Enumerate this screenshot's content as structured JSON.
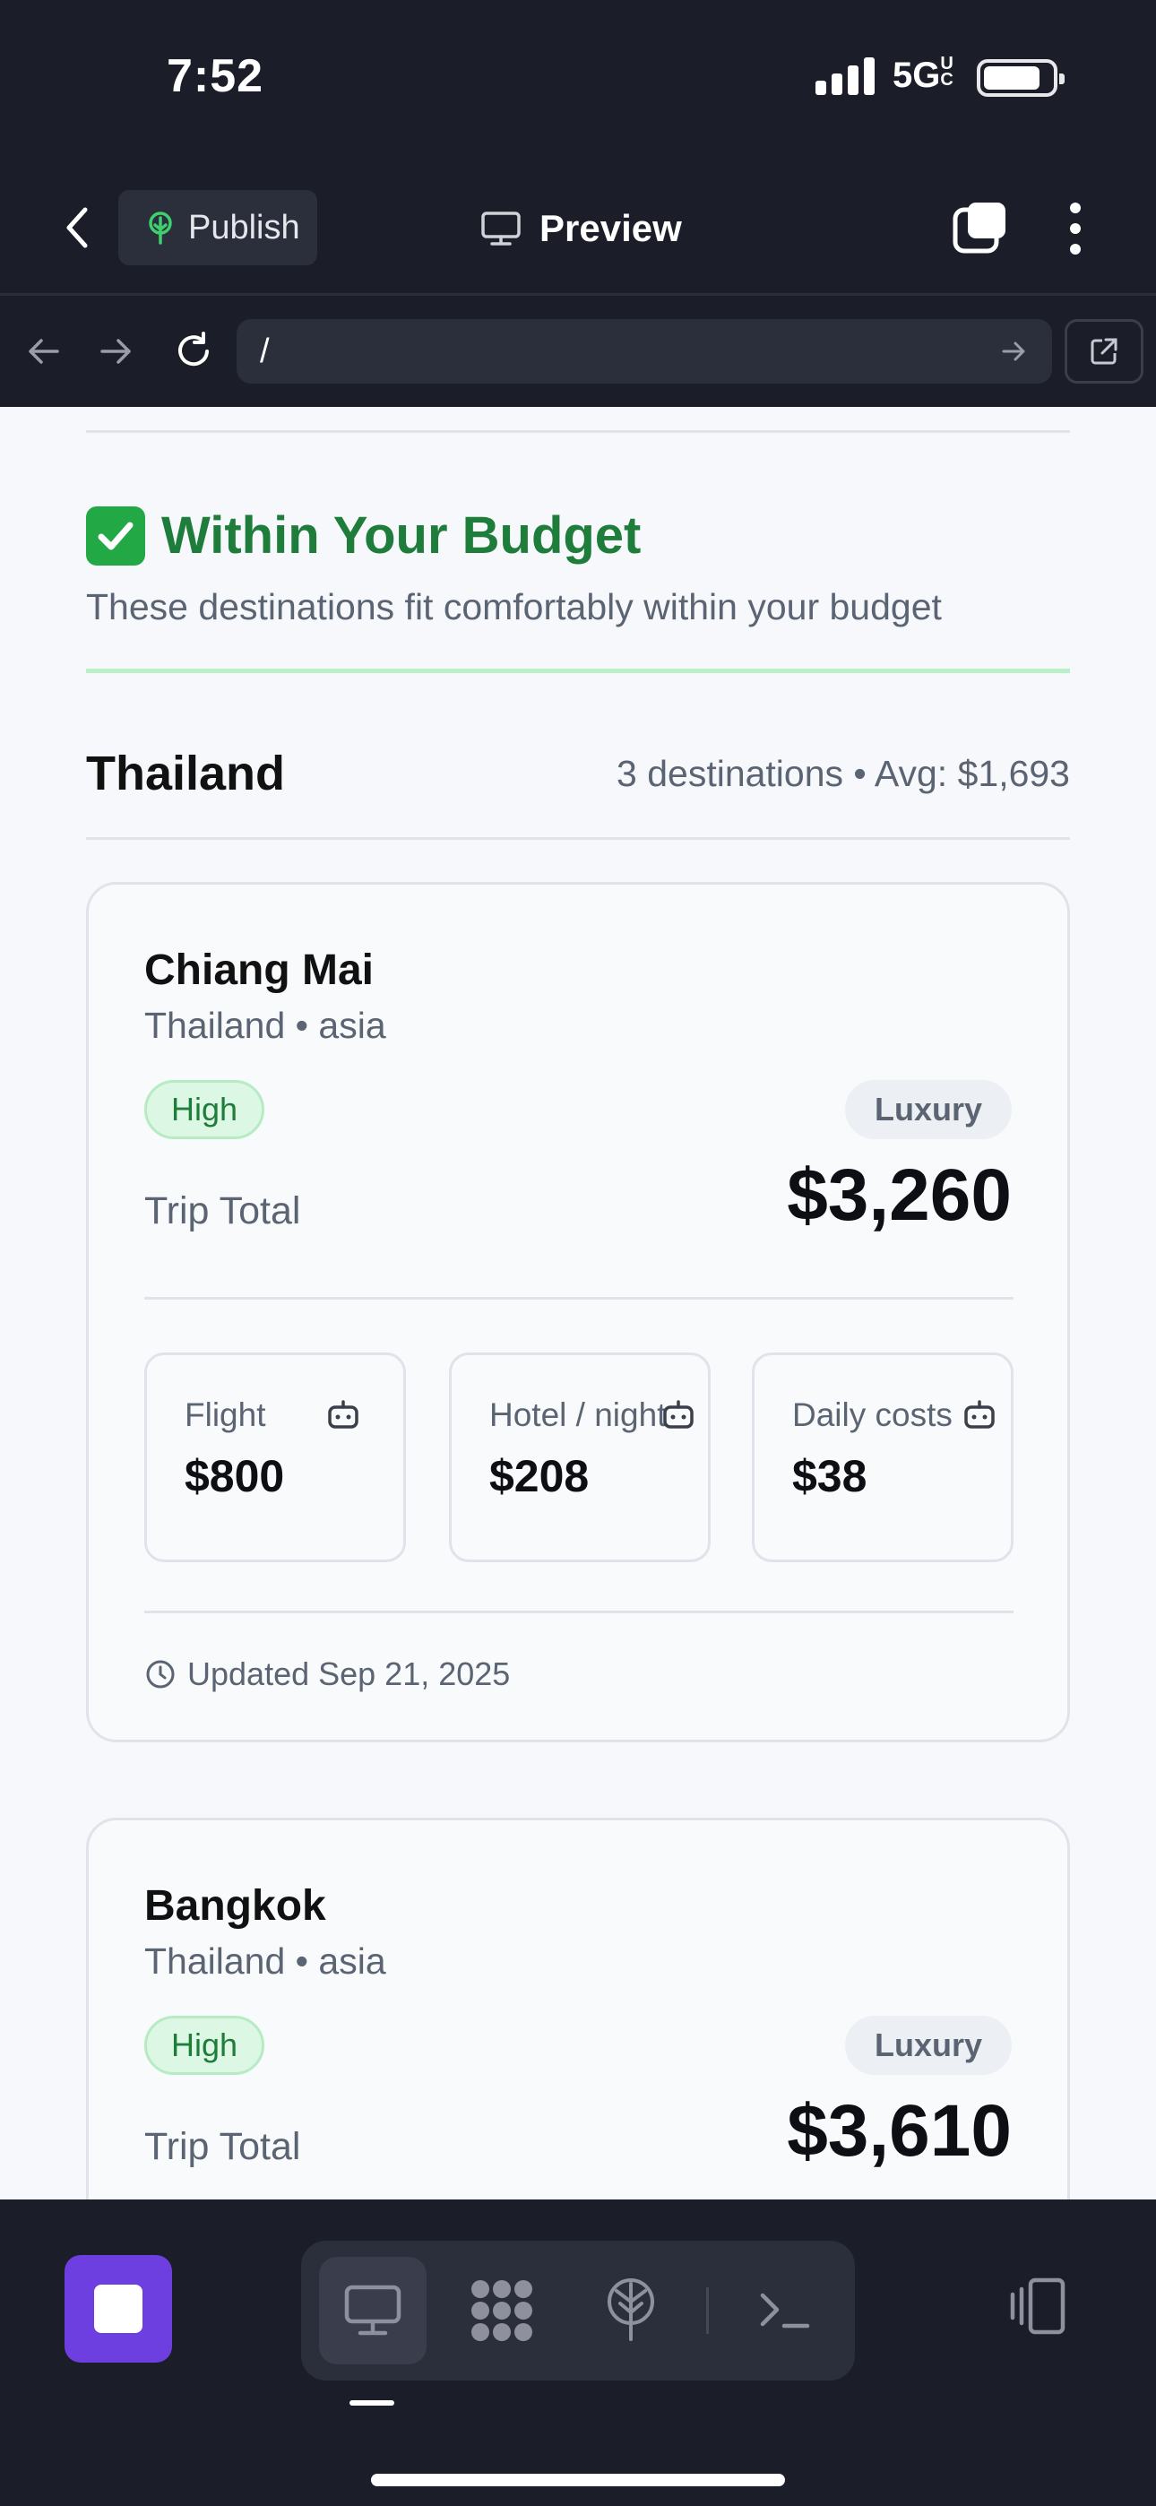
{
  "status_bar": {
    "time": "7:52",
    "network": "5G",
    "network_sup": "UC"
  },
  "app_bar": {
    "publish_label": "Publish",
    "title": "Preview"
  },
  "url_bar": {
    "url": "/"
  },
  "section": {
    "title": "Within Your Budget",
    "subtitle": "These destinations fit comfortably within your budget"
  },
  "country_group": {
    "name": "Thailand",
    "meta": "3 destinations • Avg: $1,693"
  },
  "cards": [
    {
      "city": "Chiang Mai",
      "region": "Thailand • asia",
      "badge_level": "High",
      "badge_tier": "Luxury",
      "trip_label": "Trip Total",
      "trip_total": "$3,260",
      "costs": [
        {
          "label": "Flight",
          "value": "$800"
        },
        {
          "label": "Hotel / night",
          "value": "$208"
        },
        {
          "label": "Daily costs",
          "value": "$38"
        }
      ],
      "updated": "Updated Sep 21, 2025"
    },
    {
      "city": "Bangkok",
      "region": "Thailand • asia",
      "badge_level": "High",
      "badge_tier": "Luxury",
      "trip_label": "Trip Total",
      "trip_total": "$3,610"
    }
  ],
  "colors": {
    "chrome_bg": "#1b1d29",
    "accent_green": "#1e7d3a",
    "stop_purple": "#6d3fe0",
    "content_bg": "#f6f8fb"
  },
  "icons": {
    "back": "chevron-left-icon",
    "publish": "tree-icon",
    "preview": "monitor-icon",
    "tabs": "tabs-icon",
    "more": "vertical-dots-icon",
    "nav_back": "arrow-left-icon",
    "nav_forward": "arrow-right-icon",
    "reload": "reload-icon",
    "external": "external-link-icon",
    "bot": "robot-icon",
    "clock": "clock-icon",
    "toolbar": [
      "monitor-icon",
      "dots-grid-icon",
      "antenna-icon",
      "terminal-icon"
    ],
    "device": "device-rotate-icon"
  }
}
